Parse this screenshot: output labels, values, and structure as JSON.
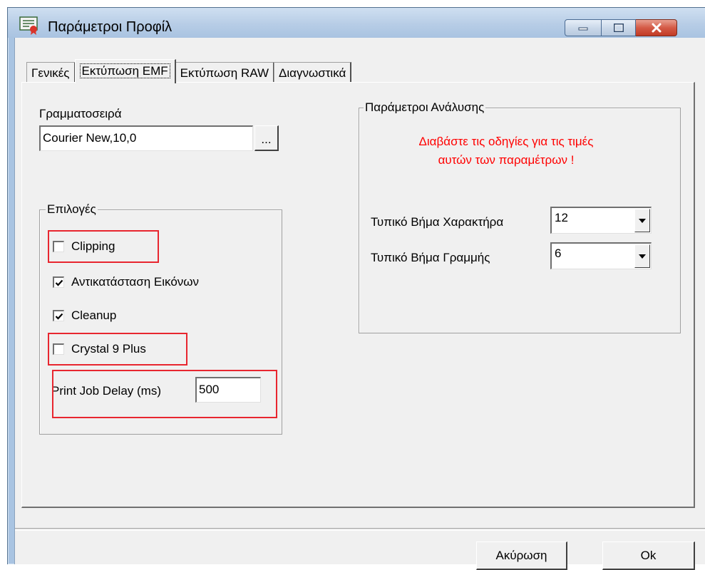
{
  "window": {
    "title": "Παράμετροι Προφίλ",
    "icon": "certificate-icon"
  },
  "tabs": [
    {
      "label": "Γενικές"
    },
    {
      "label": "Εκτύπωση EMF"
    },
    {
      "label": "Εκτύπωση RAW"
    },
    {
      "label": "Διαγνωστικά"
    }
  ],
  "active_tab": "Εκτύπωση EMF",
  "font_section": {
    "label": "Γραμματοσειρά",
    "value": "Courier New,10,0",
    "browse_label": "..."
  },
  "options": {
    "title": "Επιλογές",
    "items": [
      {
        "label": "Clipping",
        "checked": false
      },
      {
        "label": "Αντικατάσταση Εικόνων",
        "checked": true
      },
      {
        "label": "Cleanup",
        "checked": true
      },
      {
        "label": "Crystal 9 Plus",
        "checked": false
      }
    ],
    "delay_label": "Print Job Delay (ms)",
    "delay_value": "500"
  },
  "analysis": {
    "title": "Παράμετροι Ανάλυσης",
    "warning_line1": "Διαβάστε τις οδηγίες για τις τιμές",
    "warning_line2": "αυτών των παραμέτρων !",
    "char_pitch_label": "Τυπικό Βήμα Χαρακτήρα",
    "char_pitch_value": "12",
    "line_pitch_label": "Τυπικό Βήμα Γραμμής",
    "line_pitch_value": "6"
  },
  "buttons": {
    "cancel": "Ακύρωση",
    "ok": "Ok"
  },
  "colors": {
    "highlight": "#e8262f",
    "warning": "#ff0000"
  }
}
